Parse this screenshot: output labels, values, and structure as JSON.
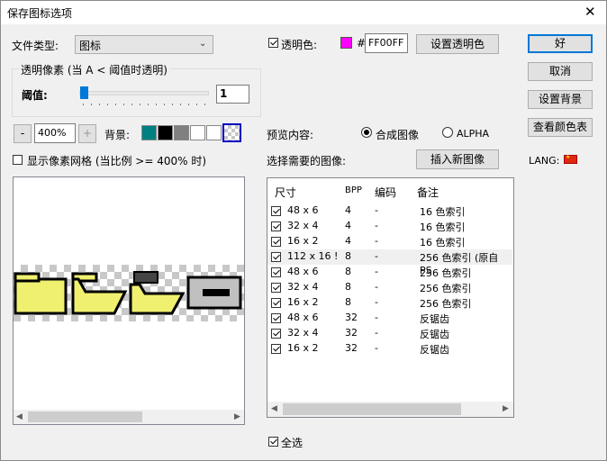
{
  "window": {
    "title": "保存图标选项",
    "close_glyph": "✕"
  },
  "file_type": {
    "label": "文件类型:",
    "value": "图标"
  },
  "transparency_group": {
    "title": "透明像素 (当 A < 阈值时透明)",
    "threshold_label": "阈值:",
    "threshold_value": "1",
    "slider_fraction": 0.004
  },
  "zoom": {
    "minus": "-",
    "value": "400%",
    "plus": "+"
  },
  "background": {
    "label": "背景:",
    "swatches": [
      "#008080",
      "#000000",
      "#808080",
      "#ffffff",
      "#ffffff"
    ]
  },
  "pixel_grid": {
    "label": "显示像素网格 (当比例 >= 400% 时)",
    "checked": false
  },
  "transparent_color": {
    "label": "透明色:",
    "checked": true,
    "hash": "#",
    "hex": "FF00FF",
    "swatch": "#ff00ff",
    "set_button": "设置透明色"
  },
  "buttons": {
    "ok": "好",
    "cancel": "取消",
    "set_bg": "设置背景",
    "view_palette": "查看颜色表"
  },
  "preview": {
    "label": "预览内容:",
    "options": [
      "合成图像",
      "ALPHA"
    ],
    "selected": 0
  },
  "select_images": {
    "label": "选择需要的图像:",
    "insert_button": "插入新图像"
  },
  "lang": {
    "label": "LANG:"
  },
  "list": {
    "headers": [
      "尺寸",
      "BPP",
      "编码",
      "备注"
    ],
    "rows": [
      {
        "size": "48 x 6",
        "bpp": "4",
        "enc": "-",
        "note": "16 色索引",
        "checked": true
      },
      {
        "size": "32 x 4",
        "bpp": "4",
        "enc": "-",
        "note": "16 色索引",
        "checked": true
      },
      {
        "size": "16 x 2",
        "bpp": "4",
        "enc": "-",
        "note": "16 色索引",
        "checked": true
      },
      {
        "size": "112 x 16 !",
        "bpp": "8",
        "enc": "-",
        "note": "256 色索引 (原自 PS",
        "checked": true
      },
      {
        "size": "48 x 6",
        "bpp": "8",
        "enc": "-",
        "note": "256 色索引",
        "checked": true
      },
      {
        "size": "32 x 4",
        "bpp": "8",
        "enc": "-",
        "note": "256 色索引",
        "checked": true
      },
      {
        "size": "16 x 2",
        "bpp": "8",
        "enc": "-",
        "note": "256 色索引",
        "checked": true
      },
      {
        "size": "48 x 6",
        "bpp": "32",
        "enc": "-",
        "note": "反锯齿",
        "checked": true
      },
      {
        "size": "32 x 4",
        "bpp": "32",
        "enc": "-",
        "note": "反锯齿",
        "checked": true
      },
      {
        "size": "16 x 2",
        "bpp": "32",
        "enc": "-",
        "note": "反锯齿",
        "checked": true
      }
    ]
  },
  "select_all": {
    "label": "全选",
    "checked": true
  }
}
